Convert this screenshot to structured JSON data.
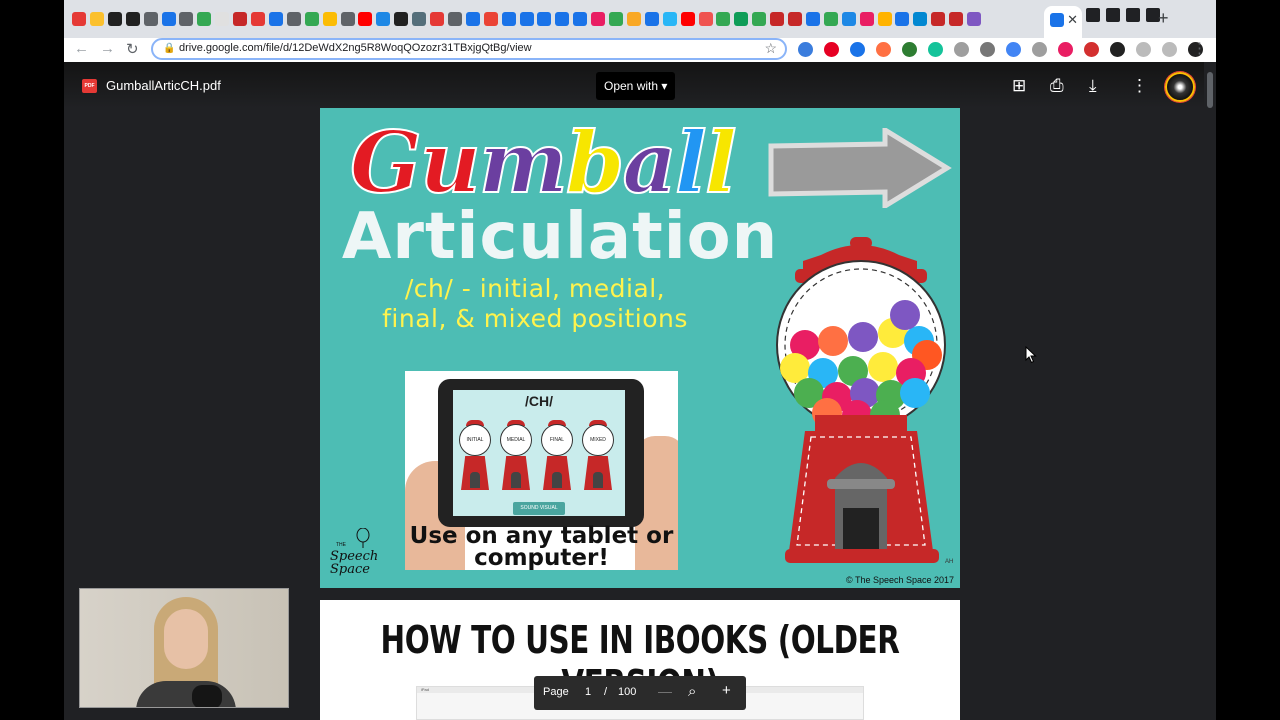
{
  "browser": {
    "active_tab": {
      "close_glyph": "✕"
    },
    "new_tab_glyph": "+",
    "url": "drive.google.com/file/d/12DeWdX2ng5R8WoqQOzozr31TBxjgQtBg/view",
    "icons": [
      "back-icon",
      "forward-icon",
      "reload-icon",
      "lock-icon",
      "star-icon",
      "menu-icon"
    ]
  },
  "viewer": {
    "file_badge": "PDF",
    "file_name": "GumballArticCH.pdf",
    "open_with_label": "Open with",
    "open_with_caret": "▾"
  },
  "page1": {
    "title_word": [
      "G",
      "u",
      "m",
      "b",
      "a",
      "l",
      "l"
    ],
    "title_colors": [
      "#e31b23",
      "#e31b23",
      "#6b3fa0",
      "#f7e600",
      "#6b3fa0",
      "#2196f3",
      "#f7e600",
      "#e31b23"
    ],
    "subtitle_word": "Articulation",
    "positions_text": "/ch/ - initial, medial, final, & mixed positions",
    "tablet": {
      "title": "/CH/",
      "machines": [
        "INITIAL",
        "MEDIAL",
        "FINAL",
        "MIXED"
      ],
      "button": "SOUND VISUAL"
    },
    "tablet_caption": "Use on any tablet or computer!",
    "logo_top": "THE",
    "logo_text": "Speech Space",
    "signature": "AH",
    "copyright": "© The Speech Space 2017"
  },
  "page2": {
    "title": "HOW TO USE IN IBOOKS (OLDER VERSION)",
    "ipad_status": "iPad"
  },
  "pager": {
    "label": "Page",
    "current": "1",
    "separator": "/",
    "total": "100",
    "zoom_out": "—",
    "zoom_in": "+"
  }
}
